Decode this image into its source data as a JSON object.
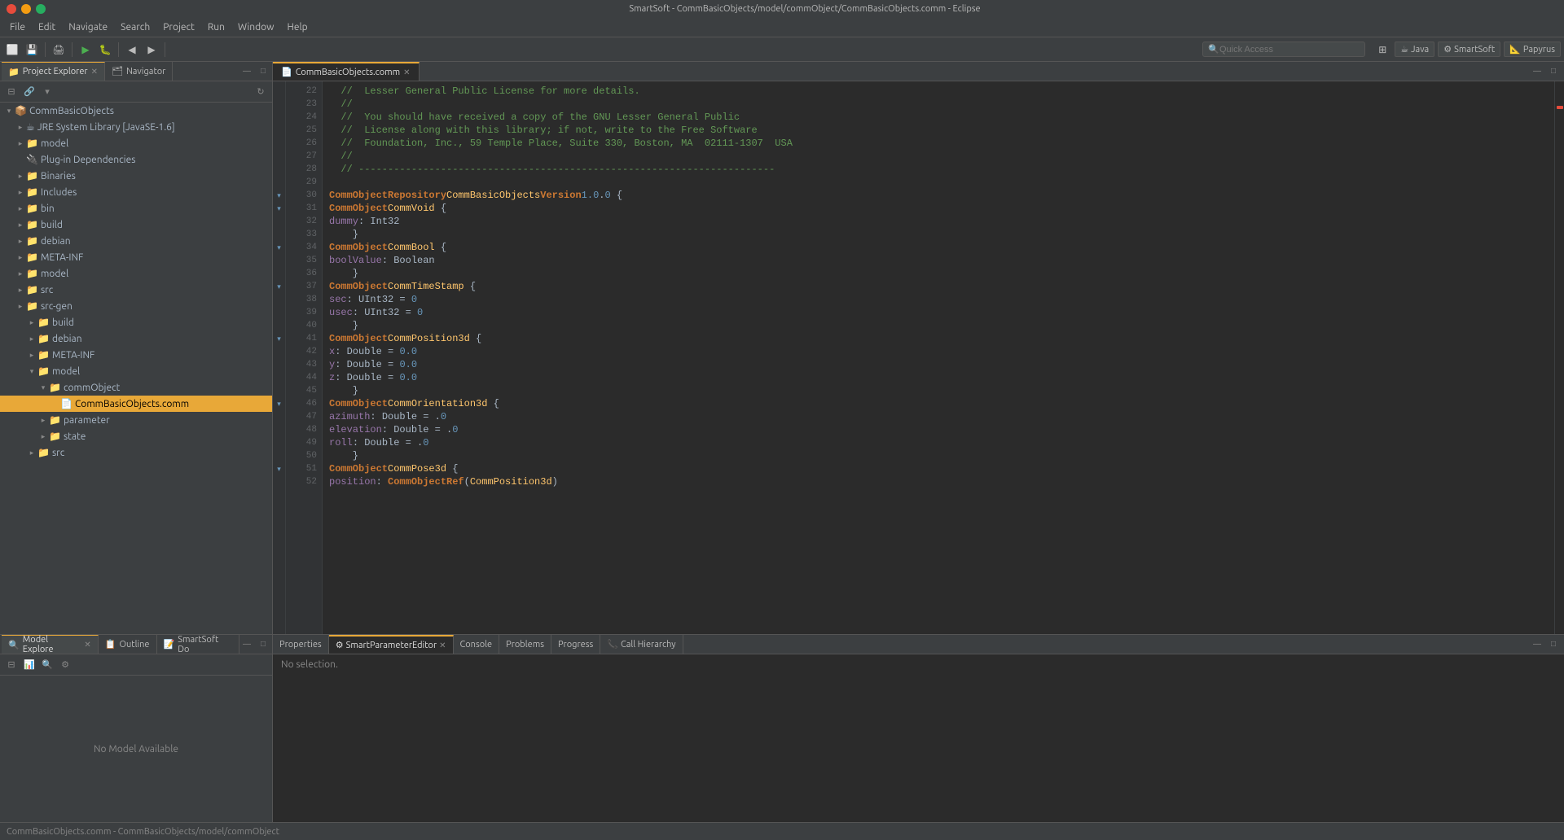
{
  "window": {
    "title": "SmartSoft - CommBasicObjects/model/commObject/CommBasicObjects.comm - Eclipse"
  },
  "menu": {
    "items": [
      "File",
      "Edit",
      "Navigate",
      "Search",
      "Project",
      "Run",
      "Window",
      "Help"
    ]
  },
  "toolbar": {
    "quick_access_placeholder": "Quick Access"
  },
  "perspectives": {
    "java_label": "Java",
    "smartsoft_label": "SmartSoft",
    "papyrus_label": "Papyrus"
  },
  "left_panel": {
    "tabs": [
      {
        "label": "Project Explorer",
        "active": true,
        "icon": "📁"
      },
      {
        "label": "Navigator",
        "active": false,
        "icon": "🗂"
      }
    ],
    "tree": [
      {
        "indent": 0,
        "arrow": "▾",
        "icon": "📦",
        "label": "CommBasicObjects",
        "level": 0
      },
      {
        "indent": 1,
        "arrow": "▸",
        "icon": "☕",
        "label": "JRE System Library [JavaSE-1.6]",
        "level": 1
      },
      {
        "indent": 1,
        "arrow": "▸",
        "icon": "📁",
        "label": "model",
        "level": 1
      },
      {
        "indent": 1,
        "arrow": " ",
        "icon": "🔌",
        "label": "Plug-in Dependencies",
        "level": 1
      },
      {
        "indent": 1,
        "arrow": "▸",
        "icon": "📁",
        "label": "Binaries",
        "level": 1
      },
      {
        "indent": 1,
        "arrow": "▸",
        "icon": "📁",
        "label": "Includes",
        "level": 1
      },
      {
        "indent": 1,
        "arrow": "▸",
        "icon": "📁",
        "label": "bin",
        "level": 1
      },
      {
        "indent": 1,
        "arrow": "▸",
        "icon": "📁",
        "label": "build",
        "level": 1
      },
      {
        "indent": 1,
        "arrow": "▸",
        "icon": "📁",
        "label": "debian",
        "level": 1
      },
      {
        "indent": 1,
        "arrow": "▸",
        "icon": "📁",
        "label": "META-INF",
        "level": 1
      },
      {
        "indent": 1,
        "arrow": "▸",
        "icon": "📁",
        "label": "model",
        "level": 1
      },
      {
        "indent": 1,
        "arrow": "▸",
        "icon": "📁",
        "label": "src",
        "level": 1
      },
      {
        "indent": 1,
        "arrow": "▸",
        "icon": "📁",
        "label": "src-gen",
        "level": 1
      },
      {
        "indent": 2,
        "arrow": "▸",
        "icon": "📁",
        "label": "build",
        "level": 2
      },
      {
        "indent": 2,
        "arrow": "▸",
        "icon": "📁",
        "label": "debian",
        "level": 2
      },
      {
        "indent": 2,
        "arrow": "▸",
        "icon": "📁",
        "label": "META-INF",
        "level": 2
      },
      {
        "indent": 2,
        "arrow": "▾",
        "icon": "📁",
        "label": "model",
        "level": 2
      },
      {
        "indent": 3,
        "arrow": "▾",
        "icon": "📁",
        "label": "commObject",
        "level": 3
      },
      {
        "indent": 4,
        "arrow": " ",
        "icon": "📄",
        "label": "CommBasicObjects.comm",
        "level": 4,
        "selected": true
      },
      {
        "indent": 3,
        "arrow": "▸",
        "icon": "📁",
        "label": "parameter",
        "level": 3
      },
      {
        "indent": 3,
        "arrow": "▸",
        "icon": "📁",
        "label": "state",
        "level": 3
      },
      {
        "indent": 2,
        "arrow": "▸",
        "icon": "📁",
        "label": "src",
        "level": 2
      }
    ]
  },
  "bottom_left_panel": {
    "tabs": [
      {
        "label": "Model Explore",
        "active": true,
        "icon": "🔍"
      },
      {
        "label": "Outline",
        "active": false,
        "icon": "📋"
      },
      {
        "label": "SmartSoft Do",
        "active": false,
        "icon": "📝"
      }
    ],
    "message": "No Model Available"
  },
  "editor": {
    "tab_label": "CommBasicObjects.comm",
    "lines": [
      {
        "num": 22,
        "content": "  //  Lesser General Public License for more details.",
        "fold": ""
      },
      {
        "num": 23,
        "content": "  //",
        "fold": ""
      },
      {
        "num": 24,
        "content": "  //  You should have received a copy of the GNU Lesser General Public",
        "fold": ""
      },
      {
        "num": 25,
        "content": "  //  License along with this library; if not, write to the Free Software",
        "fold": ""
      },
      {
        "num": 26,
        "content": "  //  Foundation, Inc., 59 Temple Place, Suite 330, Boston, MA  02111-1307  USA",
        "fold": ""
      },
      {
        "num": 27,
        "content": "  //",
        "fold": ""
      },
      {
        "num": 28,
        "content": "  // -----------------------------------------------------------------------",
        "fold": ""
      },
      {
        "num": 29,
        "content": "",
        "fold": ""
      },
      {
        "num": 30,
        "content": "CommObjectRepository CommBasicObjects Version 1.0.0 {",
        "fold": "▾"
      },
      {
        "num": 31,
        "content": "    CommObject CommVoid {",
        "fold": "▾"
      },
      {
        "num": 32,
        "content": "        dummy: Int32",
        "fold": ""
      },
      {
        "num": 33,
        "content": "    }",
        "fold": ""
      },
      {
        "num": 34,
        "content": "    CommObject CommBool {",
        "fold": "▾"
      },
      {
        "num": 35,
        "content": "        boolValue: Boolean",
        "fold": ""
      },
      {
        "num": 36,
        "content": "    }",
        "fold": ""
      },
      {
        "num": 37,
        "content": "    CommObject CommTimeStamp {",
        "fold": "▾"
      },
      {
        "num": 38,
        "content": "        sec: UInt32 = 0",
        "fold": ""
      },
      {
        "num": 39,
        "content": "        usec: UInt32 = 0",
        "fold": ""
      },
      {
        "num": 40,
        "content": "    }",
        "fold": ""
      },
      {
        "num": 41,
        "content": "    CommObject CommPosition3d {",
        "fold": "▾"
      },
      {
        "num": 42,
        "content": "        x: Double = 0.0",
        "fold": ""
      },
      {
        "num": 43,
        "content": "        y: Double = 0.0",
        "fold": ""
      },
      {
        "num": 44,
        "content": "        z: Double = 0.0",
        "fold": ""
      },
      {
        "num": 45,
        "content": "    }",
        "fold": ""
      },
      {
        "num": 46,
        "content": "    CommObject CommOrientation3d {",
        "fold": "▾"
      },
      {
        "num": 47,
        "content": "        azimuth: Double = .0",
        "fold": ""
      },
      {
        "num": 48,
        "content": "        elevation: Double = .0",
        "fold": ""
      },
      {
        "num": 49,
        "content": "        roll: Double = .0",
        "fold": ""
      },
      {
        "num": 50,
        "content": "    }",
        "fold": ""
      },
      {
        "num": 51,
        "content": "    CommObject CommPose3d {",
        "fold": "▾"
      },
      {
        "num": 52,
        "content": "        position: CommObjectRef(CommPosition3d)",
        "fold": ""
      }
    ]
  },
  "bottom_panel": {
    "tabs": [
      {
        "label": "Properties",
        "active": false
      },
      {
        "label": "SmartParameterEditor",
        "active": true
      },
      {
        "label": "Console",
        "active": false
      },
      {
        "label": "Problems",
        "active": false
      },
      {
        "label": "Progress",
        "active": false
      },
      {
        "label": "Call Hierarchy",
        "active": false
      }
    ],
    "content": "No selection."
  },
  "status_bar": {
    "text": "CommBasicObjects.comm - CommBasicObjects/model/commObject"
  }
}
